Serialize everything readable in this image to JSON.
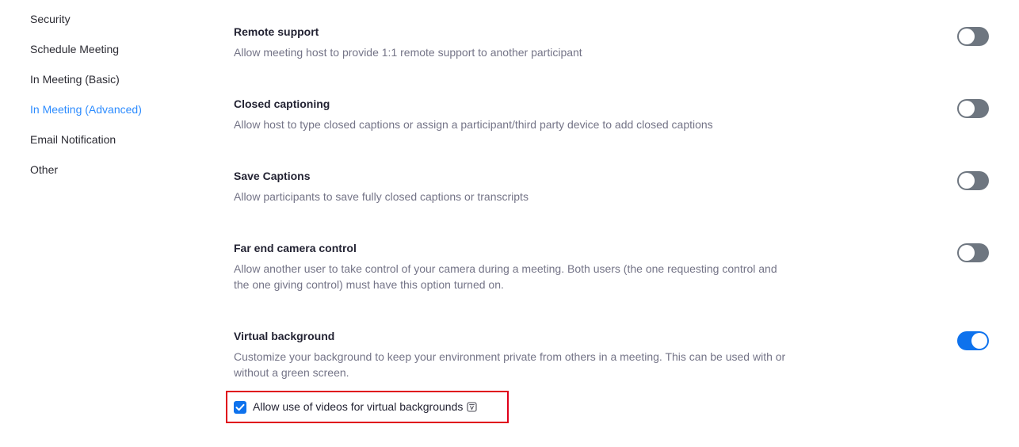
{
  "sidebar": {
    "items": [
      {
        "label": "Security",
        "active": false
      },
      {
        "label": "Schedule Meeting",
        "active": false
      },
      {
        "label": "In Meeting (Basic)",
        "active": false
      },
      {
        "label": "In Meeting (Advanced)",
        "active": true
      },
      {
        "label": "Email Notification",
        "active": false
      },
      {
        "label": "Other",
        "active": false
      }
    ]
  },
  "settings": [
    {
      "title": "Remote support",
      "description": "Allow meeting host to provide 1:1 remote support to another participant",
      "enabled": false
    },
    {
      "title": "Closed captioning",
      "description": "Allow host to type closed captions or assign a participant/third party device to add closed captions",
      "enabled": false
    },
    {
      "title": "Save Captions",
      "description": "Allow participants to save fully closed captions or transcripts",
      "enabled": false
    },
    {
      "title": "Far end camera control",
      "description_line1": "Allow another user to take control of your camera during a meeting. Both users (the one requesting control and",
      "description_line2": "the one giving control) must have this option turned on.",
      "enabled": false
    },
    {
      "title": "Virtual background",
      "description_line1": "Customize your background to keep your environment private from others in a meeting. This can be used with or",
      "description_line2": "without a green screen.",
      "enabled": true,
      "sub_option": {
        "label": "Allow use of videos for virtual backgrounds",
        "checked": true,
        "icon": "info-icon"
      }
    }
  ],
  "colors": {
    "accent": "#0e72ed",
    "active_nav": "#2d8cff",
    "toggle_off": "#6e7680",
    "highlight": "#e0001a"
  }
}
